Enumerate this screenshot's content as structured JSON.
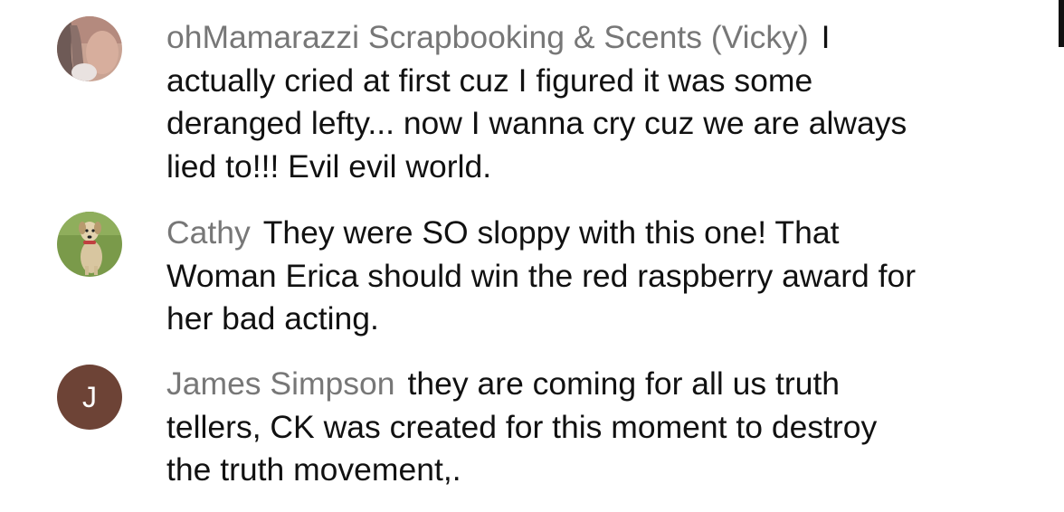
{
  "comments": [
    {
      "author": "ohMamarazzi Scrapbooking & Scents (Vicky)",
      "lines": [
        "I",
        "actually cried at first cuz I figured it was some",
        "deranged lefty... now I wanna cry cuz we are always",
        "lied to!!! Evil evil world."
      ],
      "avatar": {
        "type": "photo",
        "icon": "profile-photo"
      }
    },
    {
      "author": "Cathy",
      "lines": [
        "They were SO sloppy with this one! That",
        "Woman Erica should win the red raspberry award for",
        "her bad acting."
      ],
      "avatar": {
        "type": "photo",
        "icon": "dog-photo"
      }
    },
    {
      "author": "James Simpson",
      "lines": [
        "they are coming for all us truth",
        "tellers, CK was created for this moment to destroy",
        "the truth movement,."
      ],
      "avatar": {
        "type": "letter",
        "letter": "J",
        "color": "#6d4336"
      }
    }
  ],
  "colors": {
    "author_text": "#777777",
    "body_text": "#111111",
    "background": "#ffffff"
  }
}
